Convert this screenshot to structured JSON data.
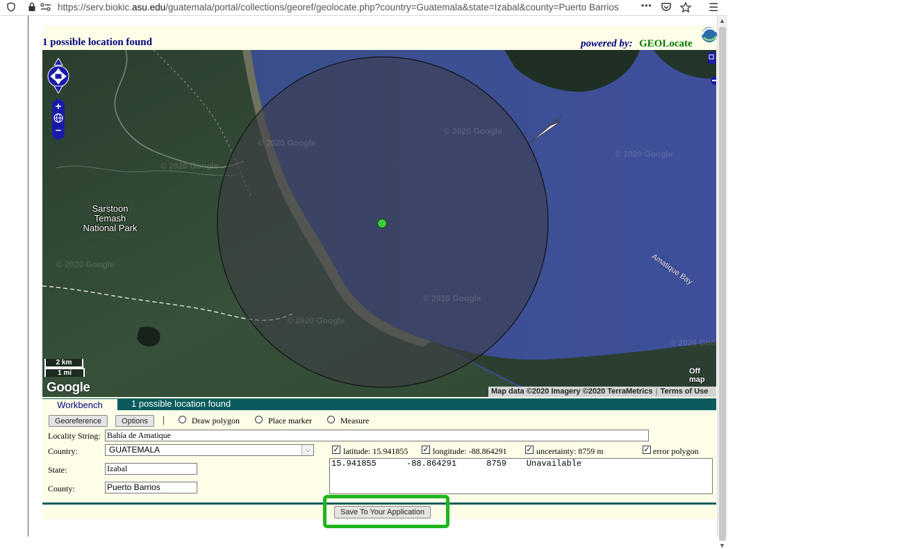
{
  "browser": {
    "url_prefix": "https://serv.biokic.",
    "url_domain": "asu.edu",
    "url_path": "/guatemala/portal/collections/georef/geolocate.php?country=Guatemala&state=Izabal&county=Puerto Barrios",
    "more_icon": "•••",
    "icons": [
      "shield-icon",
      "lock-icon",
      "permissions-icon",
      "more-icon",
      "pocket-icon",
      "star-icon",
      "menu-icon"
    ]
  },
  "header": {
    "found_text": "1 possible location found",
    "powered_by": "powered by:",
    "brand": "GEOLocate"
  },
  "map": {
    "park_label_lines": [
      "Sarstoon",
      "Temash",
      "National Park"
    ],
    "bay_label": "Amatique Bay",
    "watermark": "© 2020 Google",
    "scale_km": "2 km",
    "scale_mi": "1 mi",
    "google_logo": "Google",
    "off_map": "Off map",
    "attribution": "Map data ©2020 Imagery ©2020 TerraMetrics",
    "terms": "Terms of Use"
  },
  "tabs": {
    "active": "Workbench",
    "info": "1 possible location found"
  },
  "toolbar": {
    "georeference": "Georeference",
    "options": "Options",
    "separator": "|",
    "draw_polygon": "Draw polygon",
    "place_marker": "Place marker",
    "measure": "Measure"
  },
  "form": {
    "locality_label": "Locality String:",
    "locality_value": "Bahía de Amatique",
    "country_label": "Country:",
    "country_value": "GUATEMALA",
    "state_label": "State:",
    "state_value": "Izabal",
    "county_label": "County:",
    "county_value": "Puerto Barrios"
  },
  "results": {
    "latitude_label": "latitude: 15.941855",
    "longitude_label": "longitude: -88.864291",
    "uncertainty_label": "uncertainty: 8759 m",
    "error_polygon_label": "error polygon",
    "output_line": "15.941855      -88.864291      8759    Unavailable"
  },
  "actions": {
    "save": "Save To Your Application"
  },
  "colors": {
    "header_blue": "#000080",
    "brand_green": "#007a00",
    "tab_bar": "#0a5c5c",
    "panel_cream": "#fdfde8",
    "highlight_green": "#1fb51f",
    "marker_green": "#3cc83c"
  }
}
